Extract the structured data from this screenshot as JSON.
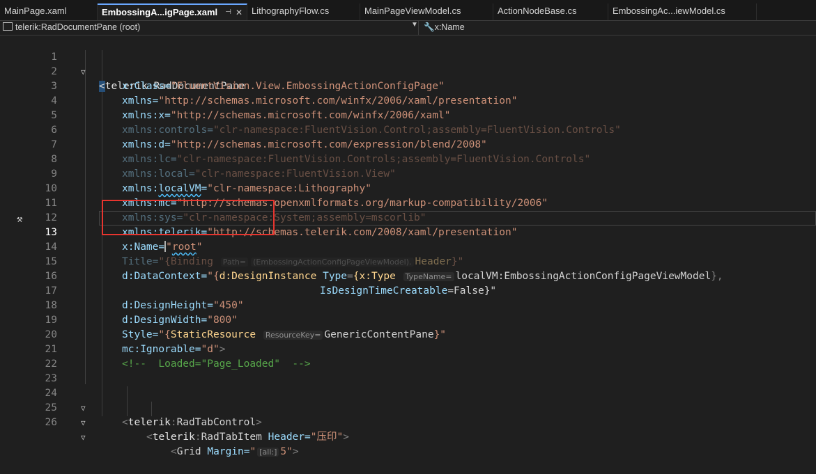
{
  "tabs": [
    {
      "label": "MainPage.xaml",
      "active": false
    },
    {
      "label": "EmbossingA...igPage.xaml",
      "active": true
    },
    {
      "label": "LithographyFlow.cs",
      "active": false
    },
    {
      "label": "MainPageViewModel.cs",
      "active": false
    },
    {
      "label": "ActionNodeBase.cs",
      "active": false
    },
    {
      "label": "EmbossingAc...iewModel.cs",
      "active": false
    }
  ],
  "nav": {
    "scope": "telerik:RadDocumentPane (root)",
    "member": "x:Name"
  },
  "line_numbers": [
    "1",
    "2",
    "3",
    "4",
    "5",
    "6",
    "7",
    "8",
    "9",
    "10",
    "11",
    "12",
    "13",
    "14",
    "15",
    "16",
    "17",
    "18",
    "19",
    "20",
    "21",
    "22",
    "23",
    "24",
    "25",
    "26"
  ],
  "current_line": "13",
  "code": {
    "l1_prefix": "telerik",
    "l1_name": "RadDocumentPane",
    "x_class": "x:Class=",
    "x_class_val": "\"FluentVision.View.EmbossingActionConfigPage\"",
    "xmlns": "xmlns=",
    "xmlns_val": "\"http://schemas.microsoft.com/winfx/2006/xaml/presentation\"",
    "xmlns_x": "xmlns:x=",
    "xmlns_x_val": "\"http://schemas.microsoft.com/winfx/2006/xaml\"",
    "xmlns_controls": "xmlns:controls=",
    "xmlns_controls_val": "\"clr-namespace:FluentVision.Control;assembly=FluentVision.Controls\"",
    "xmlns_d": "xmlns:d=",
    "xmlns_d_val": "\"http://schemas.microsoft.com/expression/blend/2008\"",
    "xmlns_lc": "xmlns:lc=",
    "xmlns_lc_val": "\"clr-namespace:FluentVision.Controls;assembly=FluentVision.Controls\"",
    "xmlns_local": "xmlns:local=",
    "xmlns_local_val": "\"clr-namespace:FluentVision.View\"",
    "xmlns_localvm_a": "xmlns:",
    "xmlns_localvm_b": "localVM",
    "xmlns_localvm_c": "=",
    "xmlns_localvm_val": "\"clr-namespace:Lithography\"",
    "xmlns_mc": "xmlns:mc=",
    "xmlns_mc_val": "\"http://schemas.openxmlformats.org/markup-compatibility/2006\"",
    "xmlns_sys": "xmlns:sys=",
    "xmlns_sys_val": "\"clr-namespace:System;assembly=mscorlib\"",
    "xmlns_telerik": "xmlns:telerik=",
    "xmlns_telerik_val": "\"http://schemas.telerik.com/2008/xaml/presentation\"",
    "x_name": "x:Name=",
    "x_name_val": "root",
    "title_attr": "Title=",
    "title_open": "\"{Binding ",
    "title_hint": "Path=",
    "title_path": "(EmbossingActionConfigPageViewModel).",
    "title_header": "Header",
    "title_close": "}\"",
    "dc_attr": "d:DataContext=",
    "dc_open": "\"{",
    "dc_ext": "d:DesignInstance ",
    "dc_type": "Type",
    "dc_eq": "=",
    "dc_xtype": "{x:Type ",
    "dc_hint": "TypeName=",
    "dc_vm": "localVM:EmbossingActionConfigPageViewModel",
    "dc_close1": "},",
    "dc_creatable": "IsDesignTimeCreatable",
    "dc_false": "=False}\"",
    "dh_attr": "d:DesignHeight=",
    "dh_val": "\"450\"",
    "dw_attr": "d:DesignWidth=",
    "dw_val": "\"800\"",
    "style_attr": "Style=",
    "style_open": "\"{",
    "style_ext": "StaticResource ",
    "style_hint": "ResourceKey=",
    "style_key": "GenericContentPane",
    "style_close": "}\"",
    "ign_attr": "mc:Ignorable=",
    "ign_val": "\"d\"",
    "comment": "<!--  Loaded=\"Page_Loaded\"  -->",
    "tab_prefix": "telerik",
    "tab_name": "RadTabControl",
    "item_prefix": "telerik",
    "item_name": "RadTabItem",
    "item_attr": "Header=",
    "item_val": "\"压印\"",
    "grid_name": "Grid",
    "grid_attr": "Margin=",
    "grid_hint": "[all:]",
    "grid_val": "5\""
  }
}
